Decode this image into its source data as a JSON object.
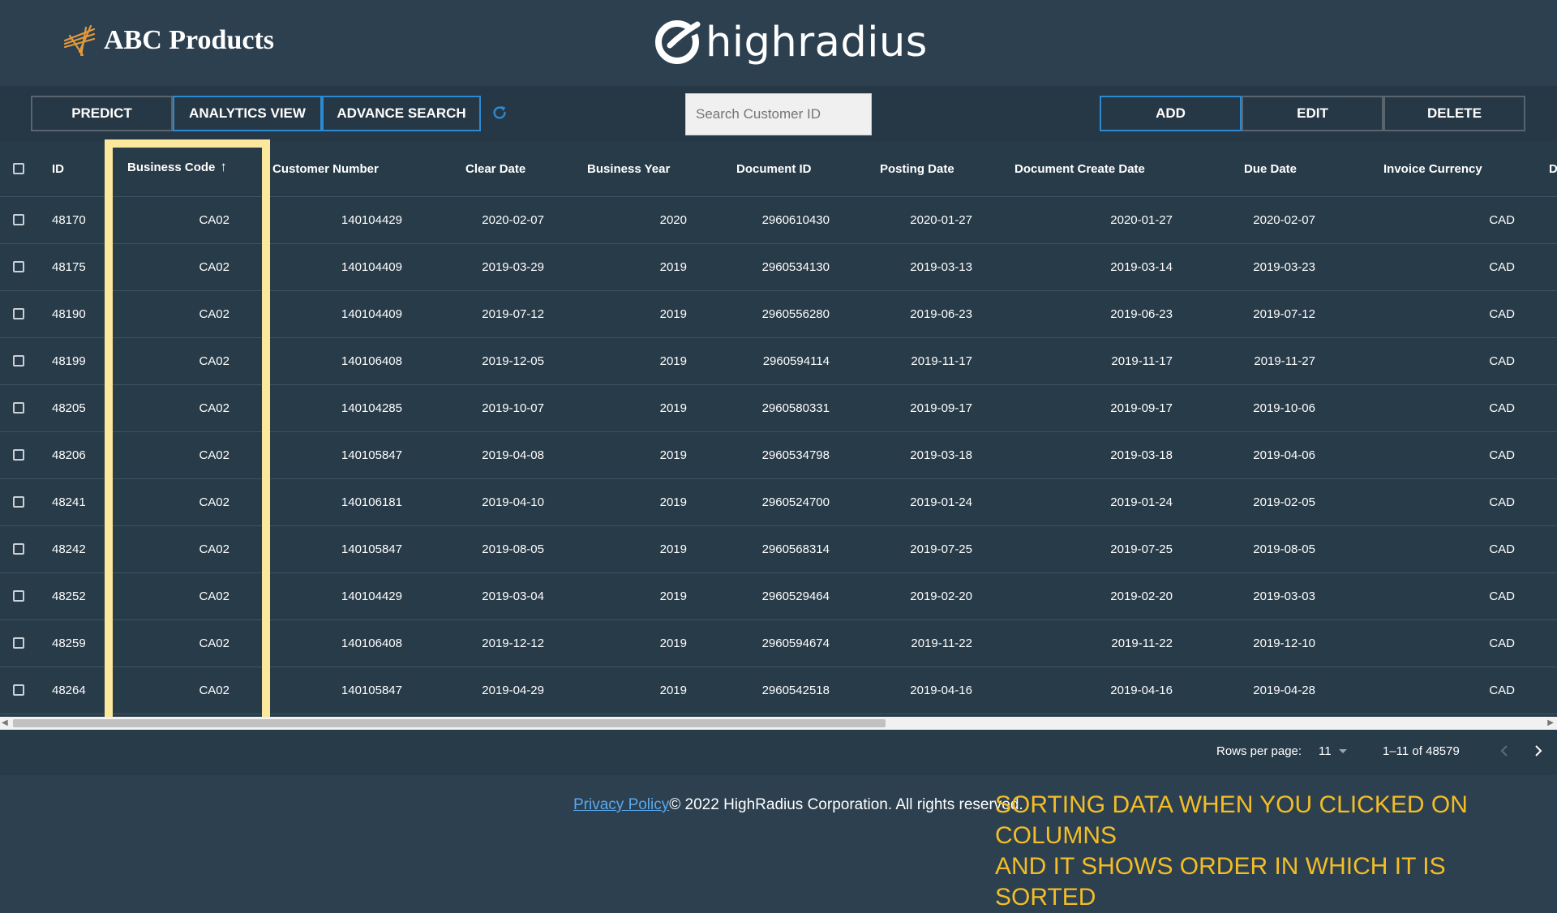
{
  "header": {
    "brand_name": "ABC Products",
    "partner_logo": "highradius"
  },
  "toolbar": {
    "predict_label": "PREDICT",
    "analytics_label": "ANALYTICS VIEW",
    "advance_search_label": "ADVANCE SEARCH",
    "search_placeholder": "Search Customer ID",
    "add_label": "ADD",
    "edit_label": "EDIT",
    "delete_label": "DELETE",
    "refresh_icon": "refresh-icon",
    "accent_color": "#2c8ad2"
  },
  "table": {
    "columns": [
      "ID",
      "Business Code",
      "Customer Number",
      "Clear Date",
      "Business Year",
      "Document ID",
      "Posting Date",
      "Document Create Date",
      "Due Date",
      "Invoice Currency",
      "D"
    ],
    "sort_indicator": "↑",
    "rows": [
      [
        "48170",
        "CA02",
        "140104429",
        "2020-02-07",
        "2020",
        "2960610430",
        "2020-01-27",
        "2020-01-27",
        "2020-02-07",
        "CAD"
      ],
      [
        "48175",
        "CA02",
        "140104409",
        "2019-03-29",
        "2019",
        "2960534130",
        "2019-03-13",
        "2019-03-14",
        "2019-03-23",
        "CAD"
      ],
      [
        "48190",
        "CA02",
        "140104409",
        "2019-07-12",
        "2019",
        "2960556280",
        "2019-06-23",
        "2019-06-23",
        "2019-07-12",
        "CAD"
      ],
      [
        "48199",
        "CA02",
        "140106408",
        "2019-12-05",
        "2019",
        "2960594114",
        "2019-11-17",
        "2019-11-17",
        "2019-11-27",
        "CAD"
      ],
      [
        "48205",
        "CA02",
        "140104285",
        "2019-10-07",
        "2019",
        "2960580331",
        "2019-09-17",
        "2019-09-17",
        "2019-10-06",
        "CAD"
      ],
      [
        "48206",
        "CA02",
        "140105847",
        "2019-04-08",
        "2019",
        "2960534798",
        "2019-03-18",
        "2019-03-18",
        "2019-04-06",
        "CAD"
      ],
      [
        "48241",
        "CA02",
        "140106181",
        "2019-04-10",
        "2019",
        "2960524700",
        "2019-01-24",
        "2019-01-24",
        "2019-02-05",
        "CAD"
      ],
      [
        "48242",
        "CA02",
        "140105847",
        "2019-08-05",
        "2019",
        "2960568314",
        "2019-07-25",
        "2019-07-25",
        "2019-08-05",
        "CAD"
      ],
      [
        "48252",
        "CA02",
        "140104429",
        "2019-03-04",
        "2019",
        "2960529464",
        "2019-02-20",
        "2019-02-20",
        "2019-03-03",
        "CAD"
      ],
      [
        "48259",
        "CA02",
        "140106408",
        "2019-12-12",
        "2019",
        "2960594674",
        "2019-11-22",
        "2019-11-22",
        "2019-12-10",
        "CAD"
      ],
      [
        "48264",
        "CA02",
        "140105847",
        "2019-04-29",
        "2019",
        "2960542518",
        "2019-04-16",
        "2019-04-16",
        "2019-04-28",
        "CAD"
      ]
    ]
  },
  "pagination": {
    "rows_per_page_label": "Rows per page:",
    "rows_per_page_value": "11",
    "range_text": "1–11 of 48579"
  },
  "footer": {
    "privacy_label": "Privacy Policy",
    "copyright": "© 2022 HighRadius Corporation. All rights reserved."
  },
  "annotation": {
    "line1": "SORTING DATA WHEN YOU CLICKED ON COLUMNS",
    "line2": "AND IT SHOWS ORDER IN WHICH IT IS SORTED",
    "highlight_color": "#fbe89c",
    "text_color": "#f3bd26"
  }
}
